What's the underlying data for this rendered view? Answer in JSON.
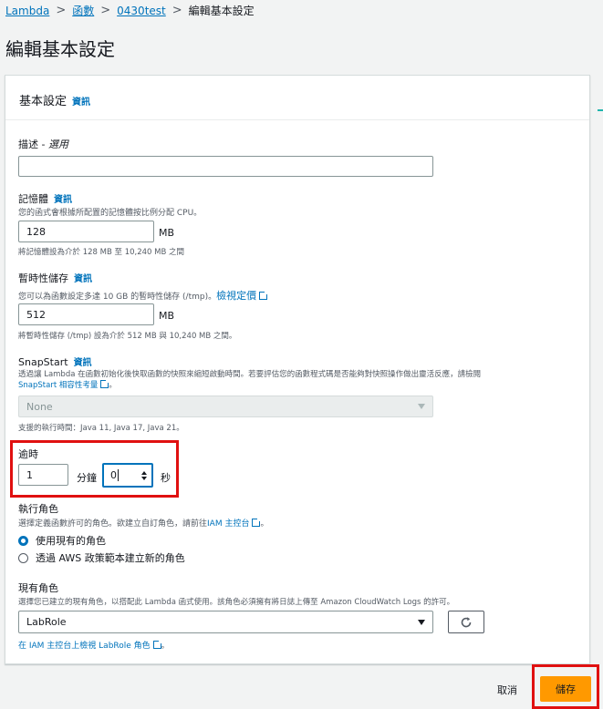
{
  "breadcrumb": {
    "items": [
      "Lambda",
      "函數",
      "0430test",
      "編輯基本設定"
    ],
    "separator": ">"
  },
  "page": {
    "title": "編輯基本設定"
  },
  "panel": {
    "title": "基本設定",
    "info": "資訊"
  },
  "description": {
    "label": "描述 - ",
    "optional": "選用",
    "value": ""
  },
  "memory": {
    "label": "記憶體",
    "info": "資訊",
    "desc": "您的函式會根據所配置的記憶體按比例分配 CPU。",
    "value": "128",
    "unit": "MB",
    "hint": "將記憶體設為介於 128 MB 至 10,240 MB 之間"
  },
  "ephemeral": {
    "label": "暫時性儲存",
    "info": "資訊",
    "desc": "您可以為函數設定多達 10 GB 的暫時性儲存 (/tmp)。",
    "link": "檢視定價",
    "value": "512",
    "unit": "MB",
    "hint": "將暫時性儲存 (/tmp) 設為介於 512 MB 與 10,240 MB 之間。"
  },
  "snapstart": {
    "label": "SnapStart",
    "info": "資訊",
    "desc": "透過讓 Lambda 在函數初始化後快取函數的快照來縮短啟動時間。若要評估您的函數程式碼是否能夠對快照操作做出靈活反應，請檢閱",
    "link": "SnapStart 相容性考量",
    "desc_end": "。",
    "selected": "None",
    "hint": "支援的執行時間：Java 11, Java 17, Java 21。"
  },
  "timeout": {
    "label": "逾時",
    "minutes": "1",
    "minutes_unit": "分鐘",
    "seconds": "0",
    "seconds_unit": "秒"
  },
  "role": {
    "label": "執行角色",
    "desc": "選擇定義函數許可的角色。欲建立自訂角色，請前往",
    "link": "IAM 主控台",
    "desc_end": "。",
    "options": [
      "使用現有的角色",
      "透過 AWS 政策範本建立新的角色"
    ],
    "selected_index": 0
  },
  "existing_role": {
    "label": "現有角色",
    "desc": "選擇您已建立的現有角色，以搭配此 Lambda 函式使用。該角色必須擁有將日誌上傳至 Amazon CloudWatch Logs 的許可。",
    "selected": "LabRole",
    "link": "在 IAM 主控台上檢視 LabRole 角色",
    "link_end": "。"
  },
  "footer": {
    "cancel": "取消",
    "save": "儲存"
  },
  "colors": {
    "link": "#0073bb",
    "primary": "#ff9900",
    "highlight": "#e01010"
  }
}
